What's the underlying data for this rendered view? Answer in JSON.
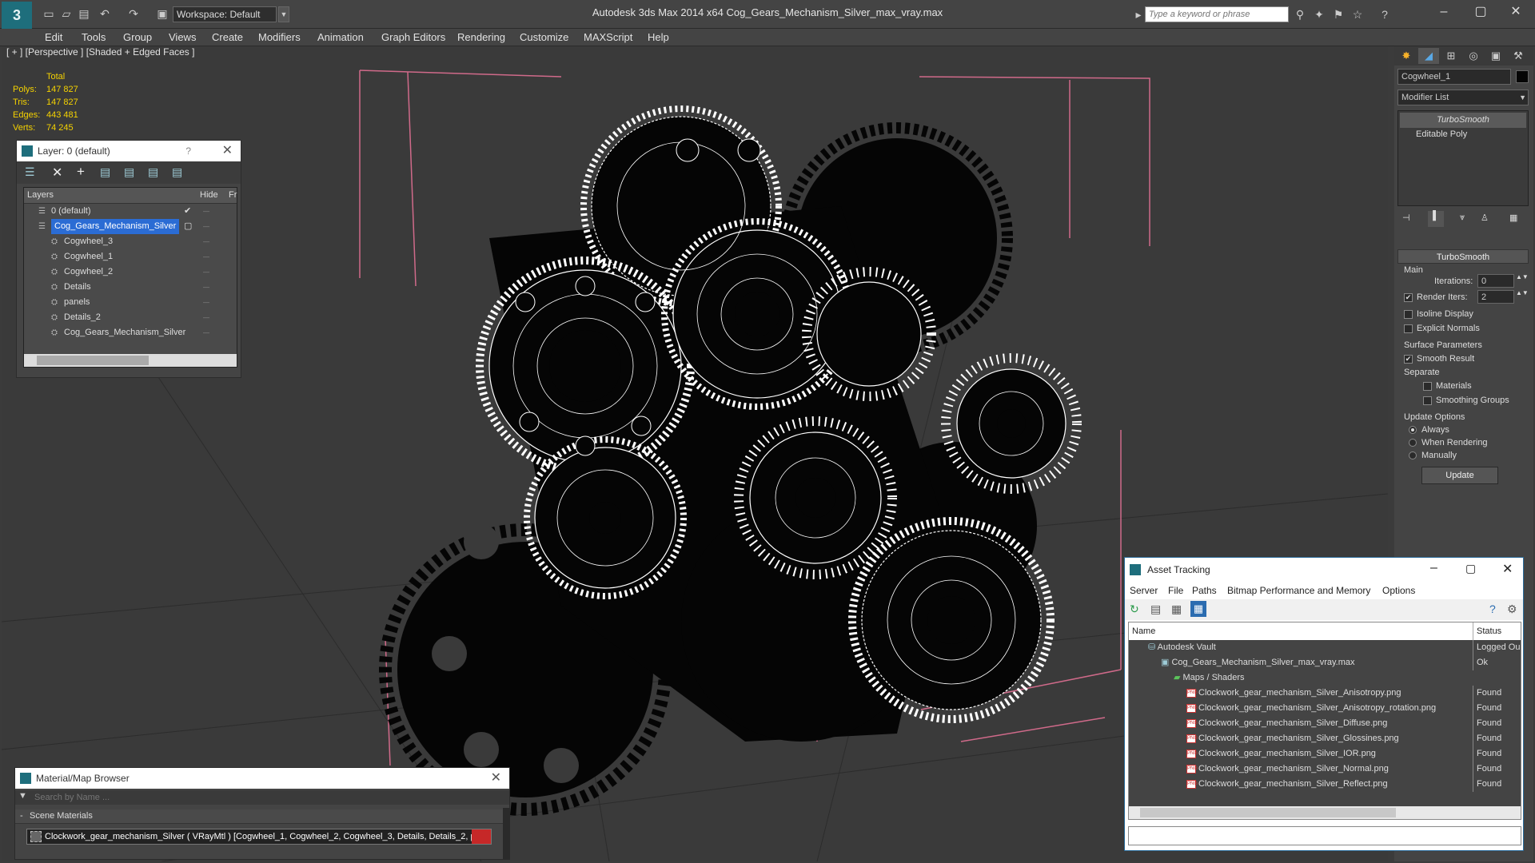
{
  "titlebar": {
    "workspace": "Workspace: Default",
    "title": "Autodesk 3ds Max  2014 x64     Cog_Gears_Mechanism_Silver_max_vray.max",
    "search_placeholder": "Type a keyword or phrase"
  },
  "menu": [
    "Edit",
    "Tools",
    "Group",
    "Views",
    "Create",
    "Modifiers",
    "Animation",
    "Graph Editors",
    "Rendering",
    "Customize",
    "MAXScript",
    "Help"
  ],
  "viewport": {
    "label": "[ + ] [Perspective ] [Shaded + Edged Faces ]",
    "stats": {
      "header": "Total",
      "rows": [
        {
          "k": "Polys:",
          "v": "147 827"
        },
        {
          "k": "Tris:",
          "v": "147 827"
        },
        {
          "k": "Edges:",
          "v": "443 481"
        },
        {
          "k": "Verts:",
          "v": "74 245"
        }
      ]
    }
  },
  "layer_dialog": {
    "title": "Layer: 0 (default)",
    "help": "?",
    "col_layers": "Layers",
    "col_hide": "Hide",
    "col_freeze": "Fr",
    "items": [
      {
        "label": "0 (default)",
        "level": 0,
        "selected": false
      },
      {
        "label": "Cog_Gears_Mechanism_Silver",
        "level": 0,
        "selected": true
      },
      {
        "label": "Cogwheel_3",
        "level": 1,
        "selected": false
      },
      {
        "label": "Cogwheel_1",
        "level": 1,
        "selected": false
      },
      {
        "label": "Cogwheel_2",
        "level": 1,
        "selected": false
      },
      {
        "label": "Details",
        "level": 1,
        "selected": false
      },
      {
        "label": "panels",
        "level": 1,
        "selected": false
      },
      {
        "label": "Details_2",
        "level": 1,
        "selected": false
      },
      {
        "label": "Cog_Gears_Mechanism_Silver",
        "level": 1,
        "selected": false
      }
    ]
  },
  "command_panel": {
    "object_name": "Cogwheel_1",
    "modifier_list": "Modifier List",
    "stack": [
      "TurboSmooth",
      "Editable Poly"
    ],
    "turbosmooth": {
      "title": "TurboSmooth",
      "main": "Main",
      "iterations_label": "Iterations:",
      "iterations": "0",
      "render_iters_label": "Render Iters:",
      "render_iters": "2",
      "isoline": "Isoline Display",
      "explicit": "Explicit Normals",
      "surface": "Surface Parameters",
      "smooth_result": "Smooth Result",
      "separate": "Separate",
      "materials": "Materials",
      "smoothing_groups": "Smoothing Groups",
      "update_options": "Update Options",
      "always": "Always",
      "when_rendering": "When Rendering",
      "manually": "Manually",
      "update": "Update"
    }
  },
  "asset_tracking": {
    "title": "Asset Tracking",
    "menu": [
      "Server",
      "File",
      "Paths",
      "Bitmap Performance and Memory",
      "Options"
    ],
    "col_name": "Name",
    "col_status": "Status",
    "rows": [
      {
        "name": "Autodesk Vault",
        "status": "Logged Ou",
        "indent": 0,
        "icon": "vault"
      },
      {
        "name": "Cog_Gears_Mechanism_Silver_max_vray.max",
        "status": "Ok",
        "indent": 1,
        "icon": "max"
      },
      {
        "name": "Maps / Shaders",
        "status": "",
        "indent": 2,
        "icon": "maps"
      },
      {
        "name": "Clockwork_gear_mechanism_Silver_Anisotropy.png",
        "status": "Found",
        "indent": 3,
        "icon": "png"
      },
      {
        "name": "Clockwork_gear_mechanism_Silver_Anisotropy_rotation.png",
        "status": "Found",
        "indent": 3,
        "icon": "png"
      },
      {
        "name": "Clockwork_gear_mechanism_Silver_Diffuse.png",
        "status": "Found",
        "indent": 3,
        "icon": "png"
      },
      {
        "name": "Clockwork_gear_mechanism_Silver_Glossines.png",
        "status": "Found",
        "indent": 3,
        "icon": "png"
      },
      {
        "name": "Clockwork_gear_mechanism_Silver_IOR.png",
        "status": "Found",
        "indent": 3,
        "icon": "png"
      },
      {
        "name": "Clockwork_gear_mechanism_Silver_Normal.png",
        "status": "Found",
        "indent": 3,
        "icon": "png"
      },
      {
        "name": "Clockwork_gear_mechanism_Silver_Reflect.png",
        "status": "Found",
        "indent": 3,
        "icon": "png"
      }
    ]
  },
  "material_browser": {
    "title": "Material/Map Browser",
    "search_placeholder": "Search by Name ...",
    "section": "Scene Materials",
    "item": "Clockwork_gear_mechanism_Silver  ( VRayMtl ) [Cogwheel_1, Cogwheel_2, Cogwheel_3, Details, Details_2, p..."
  }
}
